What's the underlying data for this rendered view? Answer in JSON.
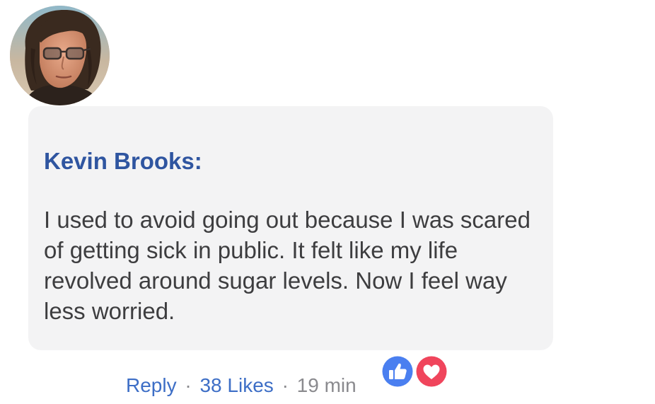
{
  "comment": {
    "author": "Kevin Brooks:",
    "text": "I used to avoid going out because I was scared of getting sick in public. It felt like my life revolved around sugar levels. Now I feel way less worried."
  },
  "actions": {
    "reply_label": "Reply",
    "separator": "·",
    "likes_label": "38 Likes",
    "timestamp": "19 min"
  },
  "reactions": [
    {
      "icon": "thumbs-up-icon",
      "color": "#4a7ff0"
    },
    {
      "icon": "heart-icon",
      "color": "#f0455c"
    }
  ],
  "colors": {
    "author_name": "#2f55a0",
    "link": "#3d6ec6",
    "bubble_bg": "#f3f3f4",
    "text": "#3d3d3f",
    "muted": "#8a8a8e"
  }
}
